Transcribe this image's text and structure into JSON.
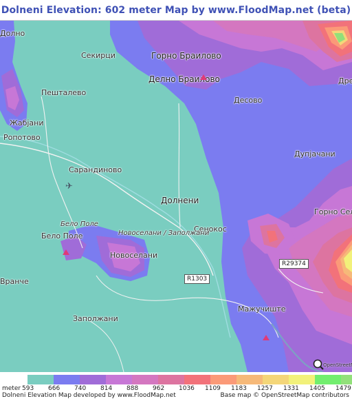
{
  "title": "Dolneni Elevation: 602 meter Map by www.FloodMap.net (beta)",
  "colors": {
    "title": "#3f51b5",
    "lowland": "#7acdc0",
    "water_blue": "#7b7cf0",
    "marker": "#e03a78"
  },
  "places": {
    "dolno": "Долно",
    "sekirci": "Секирци",
    "gorno_brailovo": "Горно Браилово",
    "delno_brailovo": "Делно Браилово",
    "dre": "Дре",
    "peshtalevo": "Пешталево",
    "zhabjani": "Жабјани",
    "desovo": "Десово",
    "ropotovo": "Ропотово",
    "dupjachani": "Дупјачани",
    "sarandinovo": "Сарандиново",
    "dolneni": "Долнени",
    "gorno_selo": "Горно Село",
    "belo_pole_it": "Бело Поле",
    "senokos": "Сенокос",
    "belo_pole": "Бело Поле",
    "novoselani_zapolzhani": "Новоселани / Заполжани",
    "novoselani": "Новоселани",
    "vranche": "Вранче",
    "mazhuchishte": "Мажучиште",
    "zapolzhani": "Заполжани"
  },
  "roads": {
    "r1303": "R1303",
    "r29374": "R29374"
  },
  "icons": {
    "airport": "airplane-icon",
    "peak": "triangle-peak-icon",
    "osm": "openstreetmap-magnifier-icon"
  },
  "osm_attribution": "OpenStreetMap",
  "legend": {
    "unit": "meter",
    "items": [
      {
        "value": "593",
        "color": "#7acdc0"
      },
      {
        "value": "666",
        "color": "#7b7cf0"
      },
      {
        "value": "740",
        "color": "#a06cd8"
      },
      {
        "value": "814",
        "color": "#c777d6"
      },
      {
        "value": "888",
        "color": "#d477c0"
      },
      {
        "value": "962",
        "color": "#dd74a0"
      },
      {
        "value": "1036",
        "color": "#f2727a"
      },
      {
        "value": "1109",
        "color": "#fb9a78"
      },
      {
        "value": "1183",
        "color": "#f6b979"
      },
      {
        "value": "1257",
        "color": "#f4d679"
      },
      {
        "value": "1331",
        "color": "#f2f17a"
      },
      {
        "value": "1405",
        "color": "#72ee6e"
      },
      {
        "value": "1479",
        "color": "#92e07a"
      }
    ]
  },
  "footer": {
    "left": "Dolneni Elevation Map developed by www.FloodMap.net",
    "right": "Base map © OpenStreetMap contributors"
  }
}
